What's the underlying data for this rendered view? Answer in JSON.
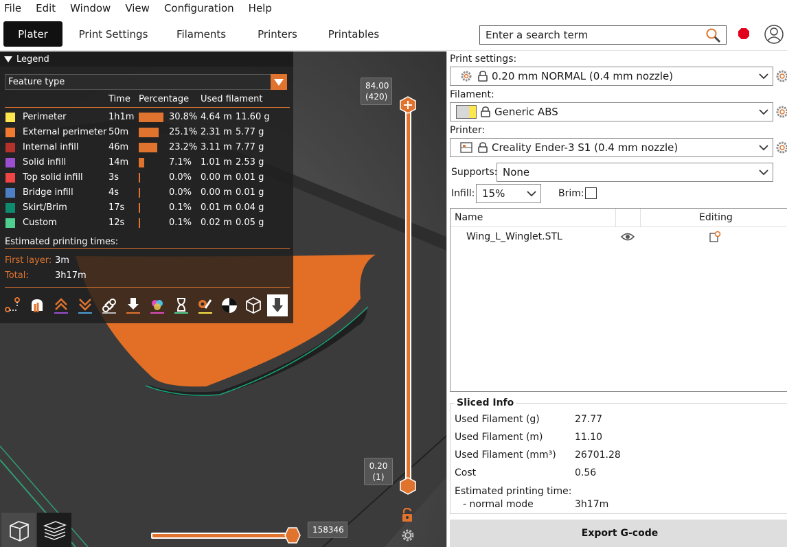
{
  "menu": [
    "File",
    "Edit",
    "Window",
    "View",
    "Configuration",
    "Help"
  ],
  "tabs": [
    {
      "label": "Plater",
      "active": true
    },
    {
      "label": "Print Settings"
    },
    {
      "label": "Filaments"
    },
    {
      "label": "Printers"
    },
    {
      "label": "Printables"
    }
  ],
  "search": {
    "placeholder": "Enter a search term"
  },
  "legend": {
    "title": "Legend",
    "view_type": "Feature type",
    "columns": [
      "Time",
      "Percentage",
      "Used filament"
    ],
    "rows": [
      {
        "name": "Perimeter",
        "color": "#fde74c",
        "time": "1h1m",
        "percent": "30.8%",
        "pct": 30.8,
        "length": "4.64 m",
        "weight": "11.60 g"
      },
      {
        "name": "External perimeter",
        "color": "#f07a30",
        "time": "50m",
        "percent": "25.1%",
        "pct": 25.1,
        "length": "2.31 m",
        "weight": "5.77 g"
      },
      {
        "name": "Internal infill",
        "color": "#b3322c",
        "time": "46m",
        "percent": "23.2%",
        "pct": 23.2,
        "length": "3.11 m",
        "weight": "7.77 g"
      },
      {
        "name": "Solid infill",
        "color": "#9b4fd0",
        "time": "14m",
        "percent": "7.1%",
        "pct": 7.1,
        "length": "1.01 m",
        "weight": "2.53 g"
      },
      {
        "name": "Top solid infill",
        "color": "#f04545",
        "time": "3s",
        "percent": "0.0%",
        "pct": 0.0,
        "length": "0.00 m",
        "weight": "0.01 g"
      },
      {
        "name": "Bridge infill",
        "color": "#4d7fc4",
        "time": "4s",
        "percent": "0.0%",
        "pct": 0.0,
        "length": "0.00 m",
        "weight": "0.01 g"
      },
      {
        "name": "Skirt/Brim",
        "color": "#108a6e",
        "time": "17s",
        "percent": "0.1%",
        "pct": 0.1,
        "length": "0.01 m",
        "weight": "0.04 g"
      },
      {
        "name": "Custom",
        "color": "#4fcf8f",
        "time": "12s",
        "percent": "0.1%",
        "pct": 0.1,
        "length": "0.02 m",
        "weight": "0.05 g"
      }
    ],
    "estimated_label": "Estimated printing times:",
    "first_layer_label": "First layer:",
    "first_layer_value": "3m",
    "total_label": "Total:",
    "total_value": "3h17m",
    "tool_icons": [
      "travel-icon",
      "retractions-icon",
      "deretractions-icon",
      "seams-icon",
      "wipes-icon",
      "tool-changes-icon",
      "color-changes-icon",
      "pauses-icon",
      "custom-gcodes-icon",
      "center-of-gravity-icon",
      "shells-icon",
      "tool-marker-icon"
    ]
  },
  "slider": {
    "top_value": "84.00",
    "top_layer": "(420)",
    "bottom_value": "0.20",
    "bottom_layer": "(1)",
    "horizontal_value": "158346"
  },
  "panel": {
    "print_settings_label": "Print settings:",
    "print_settings_value": "0.20 mm NORMAL (0.4 mm nozzle)",
    "filament_label": "Filament:",
    "filament_value": "Generic ABS",
    "printer_label": "Printer:",
    "printer_value": "Creality Ender-3 S1 (0.4 mm nozzle)",
    "supports_label": "Supports:",
    "supports_value": "None",
    "infill_label": "Infill:",
    "infill_value": "15%",
    "brim_label": "Brim:",
    "objects_header_name": "Name",
    "objects_header_editing": "Editing",
    "objects": [
      {
        "name": "Wing_L_Winglet.STL"
      }
    ],
    "sliced_title": "Sliced Info",
    "sliced": [
      {
        "label": "Used Filament (g)",
        "value": "27.77"
      },
      {
        "label": "Used Filament (m)",
        "value": "11.10"
      },
      {
        "label": "Used Filament (mm³)",
        "value": "26701.28"
      },
      {
        "label": "Cost",
        "value": "0.56"
      }
    ],
    "est_time_label": "Estimated printing time:",
    "est_mode_label": "- normal mode",
    "est_mode_value": "3h17m",
    "export_label": "Export G-code"
  },
  "colors": {
    "accent": "#e0742e",
    "bed": "#3a3a3a",
    "model": "#e26f25"
  }
}
